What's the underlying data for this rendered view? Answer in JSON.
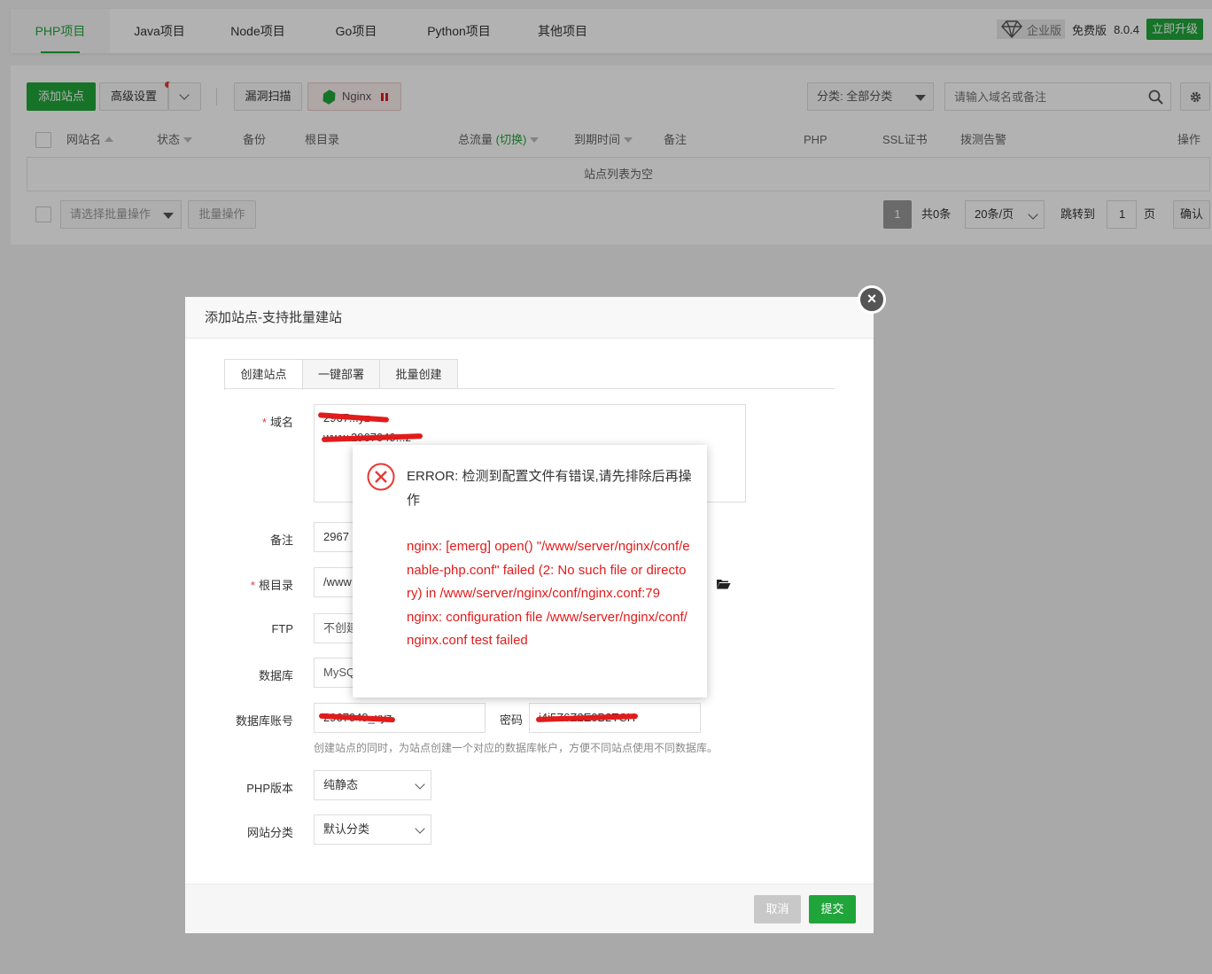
{
  "top_tabs": [
    "PHP项目",
    "Java项目",
    "Node项目",
    "Go项目",
    "Python项目",
    "其他项目"
  ],
  "version_area": {
    "enterprise": "企业版",
    "free": "免费版",
    "version": "8.0.4",
    "upgrade": "立即升级"
  },
  "toolbar": {
    "add_site": "添加站点",
    "advanced": "高级设置",
    "vuln_scan": "漏洞扫描",
    "nginx": "Nginx",
    "category": "分类: 全部分类",
    "search_placeholder": "请输入域名或备注"
  },
  "table": {
    "headers": [
      "网站名",
      "状态",
      "备份",
      "根目录",
      "总流量",
      "(切换)",
      "到期时间",
      "备注",
      "PHP",
      "SSL证书",
      "拨测告警",
      "操作"
    ],
    "empty": "站点列表为空"
  },
  "batch": {
    "placeholder": "请选择批量操作",
    "button": "批量操作"
  },
  "pager": {
    "current": "1",
    "total": "共0条",
    "per_page": "20条/页",
    "jump_label": "跳转到",
    "jump_value": "1",
    "page_unit": "页",
    "confirm": "确认"
  },
  "dialog": {
    "title": "添加站点-支持批量建站",
    "tabs": [
      "创建站点",
      "一键部署",
      "批量创建"
    ],
    "labels": {
      "domain": "域名",
      "remark": "备注",
      "root": "根目录",
      "ftp": "FTP",
      "database": "数据库",
      "db_account": "数据库账号",
      "password": "密码",
      "php_version": "PHP版本",
      "site_category": "网站分类"
    },
    "required_mark": "*",
    "values": {
      "domain_line1": "2967...yz",
      "domain_line2": "www.2967049...z",
      "remark": "2967",
      "root": "/www",
      "ftp": "不创建",
      "database": "MySQL",
      "db_account": "2967049_xyz",
      "password": "i4i5Z6Z2E0B2TCH",
      "php_version": "纯静态",
      "site_category": "默认分类"
    },
    "hint": "创建站点的同时，为站点创建一个对应的数据库帐户，方便不同站点使用不同数据库。",
    "cancel": "取消",
    "submit": "提交"
  },
  "error": {
    "title": "ERROR: 检测到配置文件有错误,请先排除后再操作",
    "detail_line1": "nginx: [emerg] open() \"/www/server/nginx/conf/enable-php.conf\" failed (2: No such file or directory) in /www/server/nginx/conf/nginx.conf:79",
    "detail_line2": "nginx: configuration file /www/server/nginx/conf/nginx.conf test failed"
  },
  "colors": {
    "accent": "#20a53a",
    "error": "#e21b1b"
  }
}
